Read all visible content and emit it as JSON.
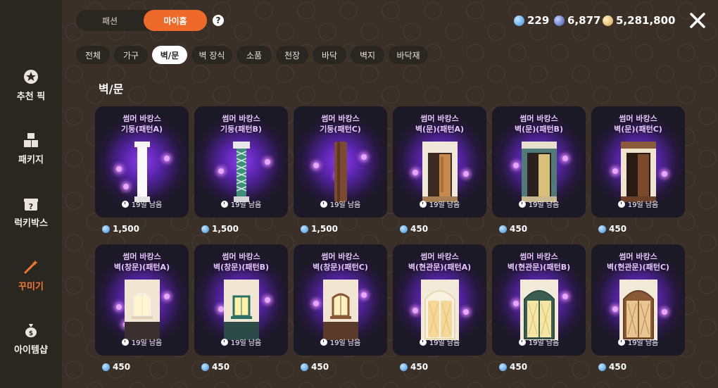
{
  "top_toggle": {
    "fashion": "패션",
    "myhome": "마이홈"
  },
  "help": "?",
  "currencies": [
    {
      "icon": "blue-gem-icon",
      "value": "229",
      "color": "#4aa6ff"
    },
    {
      "icon": "dark-gem-icon",
      "value": "6,877",
      "color": "#5b7fd6"
    },
    {
      "icon": "gold-coin-icon",
      "value": "5,281,800",
      "color": "#e8c27a"
    }
  ],
  "sidebar": [
    {
      "label": "추천 픽",
      "icon": "star-badge-icon"
    },
    {
      "label": "패키지",
      "icon": "boxes-icon"
    },
    {
      "label": "럭키박스",
      "icon": "mystery-box-icon"
    },
    {
      "label": "꾸미기",
      "icon": "magic-wand-icon"
    },
    {
      "label": "아이템샵",
      "icon": "money-bag-icon"
    }
  ],
  "categories": [
    "전체",
    "가구",
    "벽/문",
    "벽 장식",
    "소품",
    "천장",
    "바닥",
    "벽지",
    "바닥재"
  ],
  "active_category": "벽/문",
  "section_title": "벽/문",
  "remaining_text": "19일 남음",
  "items": [
    {
      "line1": "썸머 바캉스",
      "line2": "기둥(패턴A)",
      "price": "1,500"
    },
    {
      "line1": "썸머 바캉스",
      "line2": "기둥(패턴B)",
      "price": "1,500"
    },
    {
      "line1": "썸머 바캉스",
      "line2": "기둥(패턴C)",
      "price": "1,500"
    },
    {
      "line1": "썸머 바캉스",
      "line2": "벽(문)(패턴A)",
      "price": "450"
    },
    {
      "line1": "썸머 바캉스",
      "line2": "벽(문)(패턴B)",
      "price": "450"
    },
    {
      "line1": "썸머 바캉스",
      "line2": "벽(문)(패턴C)",
      "price": "450"
    },
    {
      "line1": "썸머 바캉스",
      "line2": "벽(창문)(패턴A)",
      "price": "450"
    },
    {
      "line1": "썸머 바캉스",
      "line2": "벽(창문)(패턴B)",
      "price": "450"
    },
    {
      "line1": "썸머 바캉스",
      "line2": "벽(창문)(패턴C)",
      "price": "450"
    },
    {
      "line1": "썸머 바캉스",
      "line2": "벽(현관문)(패턴A)",
      "price": "450"
    },
    {
      "line1": "썸머 바캉스",
      "line2": "벽(현관문)(패턴B)",
      "price": "450"
    },
    {
      "line1": "썸머 바캉스",
      "line2": "벽(현관문)(패턴C)",
      "price": "450"
    }
  ],
  "colors": {
    "accent": "#ee6a2b",
    "glow": "#8a3cff",
    "sidebar_bg": "#2a2622"
  }
}
